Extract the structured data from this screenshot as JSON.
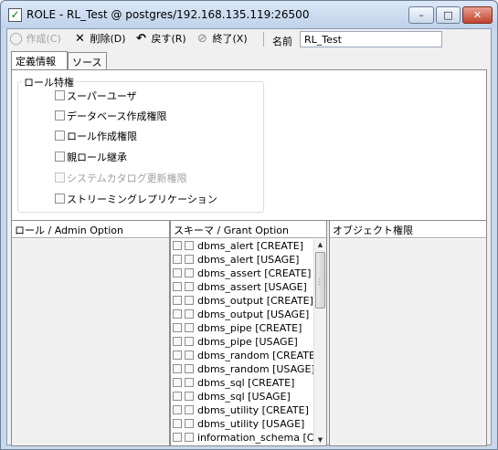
{
  "window": {
    "title": "ROLE - RL_Test @ postgres/192.168.135.119:26500",
    "check_glyph": "✓",
    "min_glyph": "–",
    "max_glyph": "□",
    "close_glyph": "✕"
  },
  "toolbar": {
    "create_label": "作成(C)",
    "delete_label": "削除(D)",
    "revert_label": "戻す(R)",
    "exit_label": "終了(X)",
    "name_label": "名前",
    "name_value": "RL_Test"
  },
  "tabs": [
    {
      "label": "定義情報"
    },
    {
      "label": "ソース"
    }
  ],
  "role_attributes": {
    "title": "ロール特権",
    "items": [
      {
        "label": "スーパーユーザ",
        "checked": false,
        "enabled": true
      },
      {
        "label": "データベース作成権限",
        "checked": false,
        "enabled": true
      },
      {
        "label": "ロール作成権限",
        "checked": false,
        "enabled": true
      },
      {
        "label": "親ロール継承",
        "checked": false,
        "enabled": true
      },
      {
        "label": "システムカタログ更新権限",
        "checked": false,
        "enabled": false
      },
      {
        "label": "ストリーミングレプリケーション",
        "checked": false,
        "enabled": true
      }
    ]
  },
  "panels": {
    "role_header": "ロール / Admin Option",
    "schema_header": "スキーマ / Grant Option",
    "object_header": "オブジェクト権限"
  },
  "schema_items": [
    "dbms_alert [CREATE]",
    "dbms_alert [USAGE]",
    "dbms_assert [CREATE]",
    "dbms_assert [USAGE]",
    "dbms_output [CREATE]",
    "dbms_output [USAGE]",
    "dbms_pipe [CREATE]",
    "dbms_pipe [USAGE]",
    "dbms_random [CREATE]",
    "dbms_random [USAGE]",
    "dbms_sql [CREATE]",
    "dbms_sql [USAGE]",
    "dbms_utility [CREATE]",
    "dbms_utility [USAGE]",
    "information_schema [CREATE]"
  ],
  "colors": {
    "title_gradient_top": "#dbe8f7",
    "close_button": "#c2432d",
    "disabled_text": "#a0a0a0"
  }
}
